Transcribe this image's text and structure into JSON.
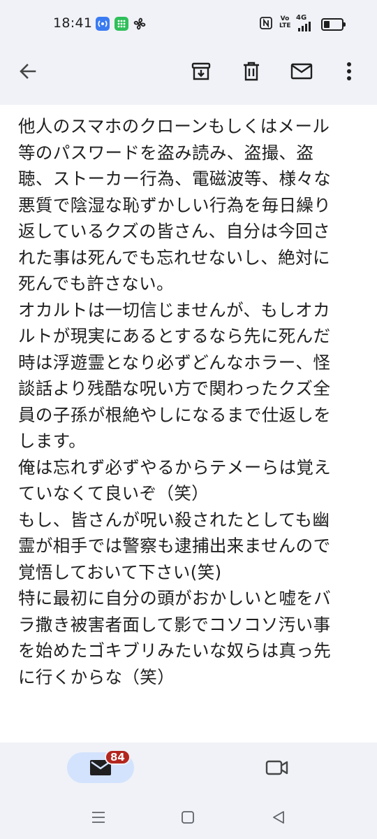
{
  "status_bar": {
    "time": "18:41",
    "network": "4G"
  },
  "toolbar": {
    "back_icon": "arrow-back-icon",
    "archive_icon": "archive-icon",
    "delete_icon": "trash-icon",
    "mark_unread_icon": "mail-icon",
    "more_icon": "more-vert-icon"
  },
  "message": {
    "lines": [
      "他人のスマホのクローンもしくはメール",
      "等のパスワードを盗み読み、盗撮、盗",
      "聴、ストーカー行為、電磁波等、様々な",
      "悪質で陰湿な恥ずかしい行為を毎日繰り",
      "返しているクズの皆さん、自分は今回さ",
      "れた事は死んでも忘れせないし、絶対に",
      "死んでも許さない。",
      "オカルトは一切信じませんが、もしオカ",
      "ルトが現実にあるとするなら先に死んだ",
      "時は浮遊霊となり必ずどんなホラー、怪",
      "談話より残酷な呪い方で関わったクズ全",
      "員の子孫が根絶やしになるまで仕返しを",
      "します。",
      "俺は忘れず必ずやるからテメーらは覚え",
      "ていなくて良いぞ（笑）",
      "もし、皆さんが呪い殺されたとしても幽",
      "霊が相手では警察も逮捕出来ませんので",
      "覚悟しておいて下さい(笑)",
      "特に最初に自分の頭がおかしいと嘘をバ",
      "ラ撒き被害者面して影でコソコソ汚い事",
      "を始めたゴキブリみたいな奴らは真っ先",
      "に行くからな（笑）"
    ]
  },
  "bottom_nav": {
    "mail_badge": "84",
    "mail_icon": "mail-icon",
    "meet_icon": "video-camera-icon"
  },
  "system_nav": {
    "recents_icon": "menu-icon",
    "home_icon": "square-icon",
    "back_icon": "triangle-back-icon"
  },
  "colors": {
    "background": "#f0f2f7",
    "content": "#ffffff",
    "pill": "#d3e3fd",
    "badge": "#b3261e"
  }
}
